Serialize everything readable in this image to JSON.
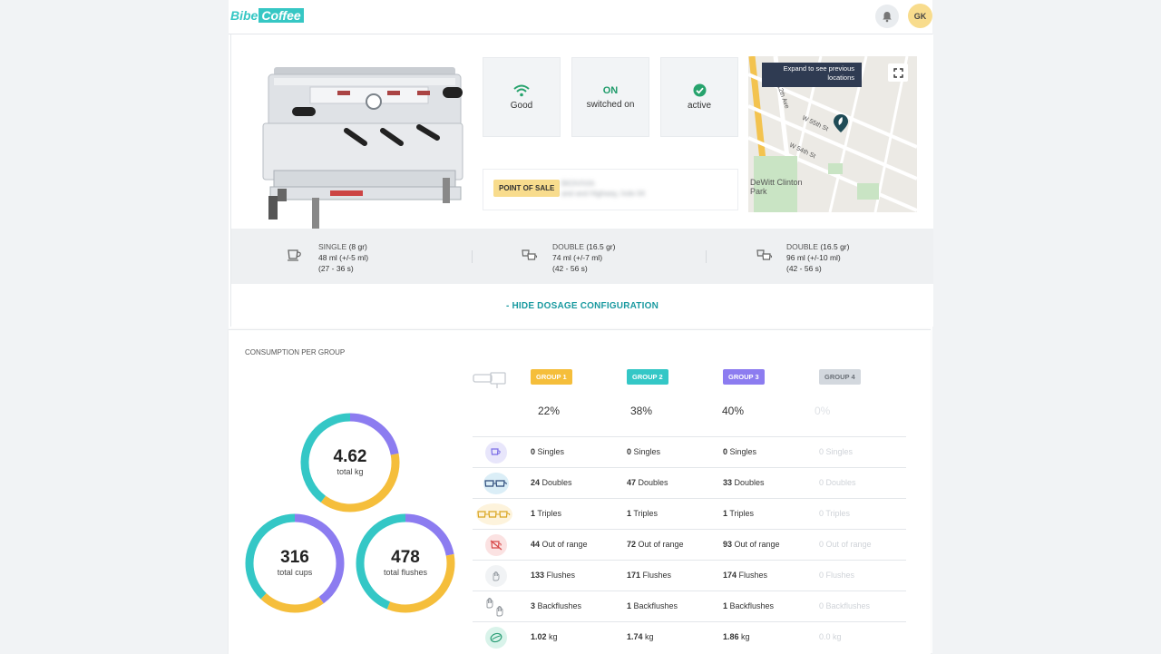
{
  "header": {
    "logo_part1": "Bibe",
    "logo_part2": "Coffee",
    "avatar_initials": "GK"
  },
  "machine": {
    "status": [
      {
        "value": "Good",
        "icon": "wifi-icon"
      },
      {
        "title": "ON",
        "value": "switched on"
      },
      {
        "value": "active",
        "icon": "check-circle-icon"
      }
    ],
    "pos_label": "POINT OF SALE",
    "pos_name": "BIOIVIVIA",
    "pos_address": "and and Highway, hole 04",
    "map": {
      "tooltip": "Expand to see previous locations",
      "park_label": "DeWitt Clinton Park",
      "street1": "W 55th St",
      "street2": "W 54th St"
    }
  },
  "dosage": [
    {
      "name": "SINGLE",
      "weight": "(8 gr)",
      "volume": "48 ml (+/-5 ml)",
      "time": "(27 - 36 s)"
    },
    {
      "name": "DOUBLE",
      "weight": "(16.5 gr)",
      "volume": "74 ml (+/-7 ml)",
      "time": "(42 - 56 s)"
    },
    {
      "name": "DOUBLE",
      "weight": "(16.5 gr)",
      "volume": "96 ml (+/-10 ml)",
      "time": "(42 - 56 s)"
    }
  ],
  "hide_dosage_label": "- HIDE DOSAGE CONFIGURATION",
  "consumption": {
    "title": "CONSUMPTION PER GROUP",
    "totals": [
      {
        "value": "4.62",
        "label": "total kg"
      },
      {
        "value": "316",
        "label": "total cups"
      },
      {
        "value": "478",
        "label": "total flushes"
      }
    ],
    "groups": [
      {
        "name": "GROUP 1",
        "color": "#f5be3b",
        "pct": "22%"
      },
      {
        "name": "GROUP 2",
        "color": "#34c7c6",
        "pct": "38%"
      },
      {
        "name": "GROUP 3",
        "color": "#8c7cf0",
        "pct": "40%"
      },
      {
        "name": "GROUP 4",
        "color": "#d3d8de",
        "pct": "0%"
      }
    ],
    "rows": [
      {
        "icon": "single-cup-icon",
        "unit": "Singles",
        "values": [
          "0",
          "0",
          "0",
          "0"
        ]
      },
      {
        "icon": "double-cup-icon",
        "unit": "Doubles",
        "values": [
          "24",
          "47",
          "33",
          "0"
        ]
      },
      {
        "icon": "triple-cup-icon",
        "unit": "Triples",
        "values": [
          "1",
          "1",
          "1",
          "0"
        ]
      },
      {
        "icon": "out-of-range-icon",
        "unit": "Out of range",
        "values": [
          "44",
          "72",
          "93",
          "0"
        ]
      },
      {
        "icon": "flush-icon",
        "unit": "Flushes",
        "values": [
          "133",
          "171",
          "174",
          "0"
        ]
      },
      {
        "icon": "backflush-icon",
        "unit": "Backflushes",
        "values": [
          "3",
          "1",
          "1",
          "0"
        ]
      },
      {
        "icon": "coffee-bean-icon",
        "unit": "kg",
        "values": [
          "1.02",
          "1.74",
          "1.86",
          "0.0"
        ]
      }
    ]
  },
  "colors": {
    "accent": "#36c7c4",
    "yellow": "#f5be3b",
    "teal": "#34c7c6",
    "purple": "#8c7cf0"
  }
}
